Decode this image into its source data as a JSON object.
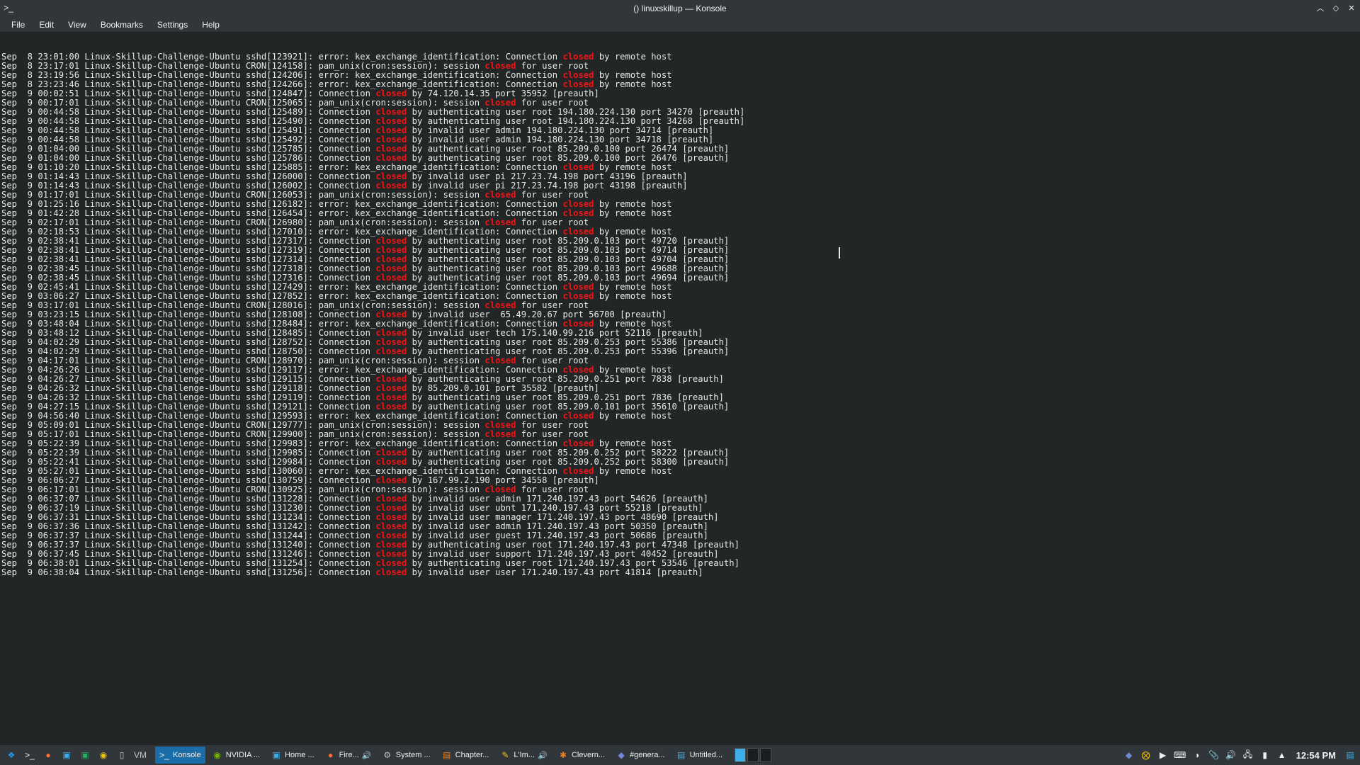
{
  "window": {
    "title": "() linuxskillup — Konsole",
    "icon_name": "terminal-icon"
  },
  "menu": [
    "File",
    "Edit",
    "View",
    "Bookmarks",
    "Settings",
    "Help"
  ],
  "log_highlight_word": "closed",
  "log_lines": [
    [
      "Sep  8 23:01:00 Linux-Skillup-Challenge-Ubuntu sshd[123921]: error: kex_exchange_identification: Connection ",
      "closed",
      " by remote host"
    ],
    [
      "Sep  8 23:17:01 Linux-Skillup-Challenge-Ubuntu CRON[124158]: pam_unix(cron:session): session ",
      "closed",
      " for user root"
    ],
    [
      "Sep  8 23:19:56 Linux-Skillup-Challenge-Ubuntu sshd[124206]: error: kex_exchange_identification: Connection ",
      "closed",
      " by remote host"
    ],
    [
      "Sep  8 23:23:46 Linux-Skillup-Challenge-Ubuntu sshd[124266]: error: kex_exchange_identification: Connection ",
      "closed",
      " by remote host"
    ],
    [
      "Sep  9 00:02:51 Linux-Skillup-Challenge-Ubuntu sshd[124847]: Connection ",
      "closed",
      " by 74.120.14.35 port 35952 [preauth]"
    ],
    [
      "Sep  9 00:17:01 Linux-Skillup-Challenge-Ubuntu CRON[125065]: pam_unix(cron:session): session ",
      "closed",
      " for user root"
    ],
    [
      "Sep  9 00:44:58 Linux-Skillup-Challenge-Ubuntu sshd[125489]: Connection ",
      "closed",
      " by authenticating user root 194.180.224.130 port 34270 [preauth]"
    ],
    [
      "Sep  9 00:44:58 Linux-Skillup-Challenge-Ubuntu sshd[125490]: Connection ",
      "closed",
      " by authenticating user root 194.180.224.130 port 34268 [preauth]"
    ],
    [
      "Sep  9 00:44:58 Linux-Skillup-Challenge-Ubuntu sshd[125491]: Connection ",
      "closed",
      " by invalid user admin 194.180.224.130 port 34714 [preauth]"
    ],
    [
      "Sep  9 00:44:58 Linux-Skillup-Challenge-Ubuntu sshd[125492]: Connection ",
      "closed",
      " by invalid user admin 194.180.224.130 port 34718 [preauth]"
    ],
    [
      "Sep  9 01:04:00 Linux-Skillup-Challenge-Ubuntu sshd[125785]: Connection ",
      "closed",
      " by authenticating user root 85.209.0.100 port 26474 [preauth]"
    ],
    [
      "Sep  9 01:04:00 Linux-Skillup-Challenge-Ubuntu sshd[125786]: Connection ",
      "closed",
      " by authenticating user root 85.209.0.100 port 26476 [preauth]"
    ],
    [
      "Sep  9 01:10:20 Linux-Skillup-Challenge-Ubuntu sshd[125885]: error: kex_exchange_identification: Connection ",
      "closed",
      " by remote host"
    ],
    [
      "Sep  9 01:14:43 Linux-Skillup-Challenge-Ubuntu sshd[126000]: Connection ",
      "closed",
      " by invalid user pi 217.23.74.198 port 43196 [preauth]"
    ],
    [
      "Sep  9 01:14:43 Linux-Skillup-Challenge-Ubuntu sshd[126002]: Connection ",
      "closed",
      " by invalid user pi 217.23.74.198 port 43198 [preauth]"
    ],
    [
      "Sep  9 01:17:01 Linux-Skillup-Challenge-Ubuntu CRON[126053]: pam_unix(cron:session): session ",
      "closed",
      " for user root"
    ],
    [
      "Sep  9 01:25:16 Linux-Skillup-Challenge-Ubuntu sshd[126182]: error: kex_exchange_identification: Connection ",
      "closed",
      " by remote host"
    ],
    [
      "Sep  9 01:42:28 Linux-Skillup-Challenge-Ubuntu sshd[126454]: error: kex_exchange_identification: Connection ",
      "closed",
      " by remote host"
    ],
    [
      "Sep  9 02:17:01 Linux-Skillup-Challenge-Ubuntu CRON[126980]: pam_unix(cron:session): session ",
      "closed",
      " for user root"
    ],
    [
      "Sep  9 02:18:53 Linux-Skillup-Challenge-Ubuntu sshd[127010]: error: kex_exchange_identification: Connection ",
      "closed",
      " by remote host"
    ],
    [
      "Sep  9 02:38:41 Linux-Skillup-Challenge-Ubuntu sshd[127317]: Connection ",
      "closed",
      " by authenticating user root 85.209.0.103 port 49720 [preauth]"
    ],
    [
      "Sep  9 02:38:41 Linux-Skillup-Challenge-Ubuntu sshd[127319]: Connection ",
      "closed",
      " by authenticating user root 85.209.0.103 port 49714 [preauth]"
    ],
    [
      "Sep  9 02:38:41 Linux-Skillup-Challenge-Ubuntu sshd[127314]: Connection ",
      "closed",
      " by authenticating user root 85.209.0.103 port 49704 [preauth]"
    ],
    [
      "Sep  9 02:38:45 Linux-Skillup-Challenge-Ubuntu sshd[127318]: Connection ",
      "closed",
      " by authenticating user root 85.209.0.103 port 49688 [preauth]"
    ],
    [
      "Sep  9 02:38:45 Linux-Skillup-Challenge-Ubuntu sshd[127316]: Connection ",
      "closed",
      " by authenticating user root 85.209.0.103 port 49694 [preauth]"
    ],
    [
      "Sep  9 02:45:41 Linux-Skillup-Challenge-Ubuntu sshd[127429]: error: kex_exchange_identification: Connection ",
      "closed",
      " by remote host"
    ],
    [
      "Sep  9 03:06:27 Linux-Skillup-Challenge-Ubuntu sshd[127852]: error: kex_exchange_identification: Connection ",
      "closed",
      " by remote host"
    ],
    [
      "Sep  9 03:17:01 Linux-Skillup-Challenge-Ubuntu CRON[128016]: pam_unix(cron:session): session ",
      "closed",
      " for user root"
    ],
    [
      "Sep  9 03:23:15 Linux-Skillup-Challenge-Ubuntu sshd[128108]: Connection ",
      "closed",
      " by invalid user  65.49.20.67 port 56700 [preauth]"
    ],
    [
      "Sep  9 03:48:04 Linux-Skillup-Challenge-Ubuntu sshd[128484]: error: kex_exchange_identification: Connection ",
      "closed",
      " by remote host"
    ],
    [
      "Sep  9 03:48:12 Linux-Skillup-Challenge-Ubuntu sshd[128485]: Connection ",
      "closed",
      " by invalid user tech 175.140.99.216 port 52116 [preauth]"
    ],
    [
      "Sep  9 04:02:29 Linux-Skillup-Challenge-Ubuntu sshd[128752]: Connection ",
      "closed",
      " by authenticating user root 85.209.0.253 port 55386 [preauth]"
    ],
    [
      "Sep  9 04:02:29 Linux-Skillup-Challenge-Ubuntu sshd[128750]: Connection ",
      "closed",
      " by authenticating user root 85.209.0.253 port 55396 [preauth]"
    ],
    [
      "Sep  9 04:17:01 Linux-Skillup-Challenge-Ubuntu CRON[128970]: pam_unix(cron:session): session ",
      "closed",
      " for user root"
    ],
    [
      "Sep  9 04:26:26 Linux-Skillup-Challenge-Ubuntu sshd[129117]: error: kex_exchange_identification: Connection ",
      "closed",
      " by remote host"
    ],
    [
      "Sep  9 04:26:27 Linux-Skillup-Challenge-Ubuntu sshd[129115]: Connection ",
      "closed",
      " by authenticating user root 85.209.0.251 port 7838 [preauth]"
    ],
    [
      "Sep  9 04:26:32 Linux-Skillup-Challenge-Ubuntu sshd[129118]: Connection ",
      "closed",
      " by 85.209.0.101 port 35582 [preauth]"
    ],
    [
      "Sep  9 04:26:32 Linux-Skillup-Challenge-Ubuntu sshd[129119]: Connection ",
      "closed",
      " by authenticating user root 85.209.0.251 port 7836 [preauth]"
    ],
    [
      "Sep  9 04:27:15 Linux-Skillup-Challenge-Ubuntu sshd[129121]: Connection ",
      "closed",
      " by authenticating user root 85.209.0.101 port 35610 [preauth]"
    ],
    [
      "Sep  9 04:56:40 Linux-Skillup-Challenge-Ubuntu sshd[129593]: error: kex_exchange_identification: Connection ",
      "closed",
      " by remote host"
    ],
    [
      "Sep  9 05:09:01 Linux-Skillup-Challenge-Ubuntu CRON[129777]: pam_unix(cron:session): session ",
      "closed",
      " for user root"
    ],
    [
      "Sep  9 05:17:01 Linux-Skillup-Challenge-Ubuntu CRON[129900]: pam_unix(cron:session): session ",
      "closed",
      " for user root"
    ],
    [
      "Sep  9 05:22:39 Linux-Skillup-Challenge-Ubuntu sshd[129983]: error: kex_exchange_identification: Connection ",
      "closed",
      " by remote host"
    ],
    [
      "Sep  9 05:22:39 Linux-Skillup-Challenge-Ubuntu sshd[129985]: Connection ",
      "closed",
      " by authenticating user root 85.209.0.252 port 58222 [preauth]"
    ],
    [
      "Sep  9 05:22:41 Linux-Skillup-Challenge-Ubuntu sshd[129984]: Connection ",
      "closed",
      " by authenticating user root 85.209.0.252 port 58300 [preauth]"
    ],
    [
      "Sep  9 05:27:01 Linux-Skillup-Challenge-Ubuntu sshd[130060]: error: kex_exchange_identification: Connection ",
      "closed",
      " by remote host"
    ],
    [
      "Sep  9 06:06:27 Linux-Skillup-Challenge-Ubuntu sshd[130759]: Connection ",
      "closed",
      " by 167.99.2.190 port 34558 [preauth]"
    ],
    [
      "Sep  9 06:17:01 Linux-Skillup-Challenge-Ubuntu CRON[130925]: pam_unix(cron:session): session ",
      "closed",
      " for user root"
    ],
    [
      "Sep  9 06:37:07 Linux-Skillup-Challenge-Ubuntu sshd[131228]: Connection ",
      "closed",
      " by invalid user admin 171.240.197.43 port 54626 [preauth]"
    ],
    [
      "Sep  9 06:37:19 Linux-Skillup-Challenge-Ubuntu sshd[131230]: Connection ",
      "closed",
      " by invalid user ubnt 171.240.197.43 port 55218 [preauth]"
    ],
    [
      "Sep  9 06:37:31 Linux-Skillup-Challenge-Ubuntu sshd[131234]: Connection ",
      "closed",
      " by invalid user manager 171.240.197.43 port 48690 [preauth]"
    ],
    [
      "Sep  9 06:37:36 Linux-Skillup-Challenge-Ubuntu sshd[131242]: Connection ",
      "closed",
      " by invalid user admin 171.240.197.43 port 50350 [preauth]"
    ],
    [
      "Sep  9 06:37:37 Linux-Skillup-Challenge-Ubuntu sshd[131244]: Connection ",
      "closed",
      " by invalid user guest 171.240.197.43 port 50686 [preauth]"
    ],
    [
      "Sep  9 06:37:37 Linux-Skillup-Challenge-Ubuntu sshd[131240]: Connection ",
      "closed",
      " by authenticating user root 171.240.197.43 port 47348 [preauth]"
    ],
    [
      "Sep  9 06:37:45 Linux-Skillup-Challenge-Ubuntu sshd[131246]: Connection ",
      "closed",
      " by invalid user support 171.240.197.43 port 40452 [preauth]"
    ],
    [
      "Sep  9 06:38:01 Linux-Skillup-Challenge-Ubuntu sshd[131254]: Connection ",
      "closed",
      " by authenticating user root 171.240.197.43 port 53546 [preauth]"
    ],
    [
      "Sep  9 06:38:04 Linux-Skillup-Challenge-Ubuntu sshd[131256]: Connection ",
      "closed",
      " by invalid user user 171.240.197.43 port 41814 [preauth]"
    ]
  ],
  "taskbar": {
    "launchers": [
      {
        "name": "kde-start-icon",
        "glyph": "❖",
        "color": "#1d99f3"
      },
      {
        "name": "terminal-launch-icon",
        "glyph": ">_",
        "color": "#eff0f1"
      },
      {
        "name": "firefox-icon",
        "glyph": "●",
        "color": "#ff7139"
      },
      {
        "name": "files-icon",
        "glyph": "▣",
        "color": "#3daee9"
      },
      {
        "name": "image-icon",
        "glyph": "▣",
        "color": "#27ae60"
      },
      {
        "name": "chrome-icon",
        "glyph": "◉",
        "color": "#f1c40f"
      },
      {
        "name": "phone-icon",
        "glyph": "▯",
        "color": "#bdc3c7"
      },
      {
        "name": "vm-icon",
        "glyph": "VM",
        "color": "#bdc3c7"
      }
    ],
    "tasks": [
      {
        "name": "task-konsole",
        "icon": ">_",
        "icon_color": "#eff0f1",
        "label": "Konsole",
        "active": true,
        "audio": false
      },
      {
        "name": "task-nvidia",
        "icon": "◉",
        "icon_color": "#76b900",
        "label": "NVIDIA ...",
        "active": false,
        "audio": false
      },
      {
        "name": "task-home",
        "icon": "▣",
        "icon_color": "#3daee9",
        "label": "Home ...",
        "active": false,
        "audio": false
      },
      {
        "name": "task-firefox",
        "icon": "●",
        "icon_color": "#ff7139",
        "label": "Fire...",
        "active": false,
        "audio": true
      },
      {
        "name": "task-system",
        "icon": "⚙",
        "icon_color": "#bdc3c7",
        "label": "System ...",
        "active": false,
        "audio": false
      },
      {
        "name": "task-chapter",
        "icon": "▤",
        "icon_color": "#e67e22",
        "label": "Chapter...",
        "active": false,
        "audio": false
      },
      {
        "name": "task-lim",
        "icon": "✎",
        "icon_color": "#f1c40f",
        "label": "L'Im...",
        "active": false,
        "audio": true
      },
      {
        "name": "task-clevern",
        "icon": "✱",
        "icon_color": "#e67e22",
        "label": "Clevern...",
        "active": false,
        "audio": false
      },
      {
        "name": "task-genera",
        "icon": "◆",
        "icon_color": "#7289da",
        "label": "#genera...",
        "active": false,
        "audio": false
      },
      {
        "name": "task-untitled",
        "icon": "▤",
        "icon_color": "#3daee9",
        "label": "Untitled...",
        "active": false,
        "audio": false
      }
    ],
    "tray_icons": [
      {
        "name": "discord-tray-icon",
        "glyph": "◆",
        "color": "#7289da"
      },
      {
        "name": "status-tray-icon",
        "glyph": "⨂",
        "color": "#f1c40f"
      },
      {
        "name": "media-tray-icon",
        "glyph": "▶",
        "color": "#eff0f1"
      },
      {
        "name": "keyboard-tray-icon",
        "glyph": "⌨",
        "color": "#eff0f1"
      },
      {
        "name": "steam-tray-icon",
        "glyph": "◑",
        "color": "#eff0f1"
      },
      {
        "name": "clipboard-tray-icon",
        "glyph": "📎",
        "color": "#eff0f1"
      },
      {
        "name": "volume-tray-icon",
        "glyph": "🔊",
        "color": "#eff0f1"
      },
      {
        "name": "network-tray-icon",
        "glyph": "🖧",
        "color": "#eff0f1"
      },
      {
        "name": "battery-tray-icon",
        "glyph": "▮",
        "color": "#eff0f1"
      },
      {
        "name": "expand-tray-icon",
        "glyph": "▲",
        "color": "#eff0f1"
      }
    ],
    "clock": "12:54 PM"
  }
}
